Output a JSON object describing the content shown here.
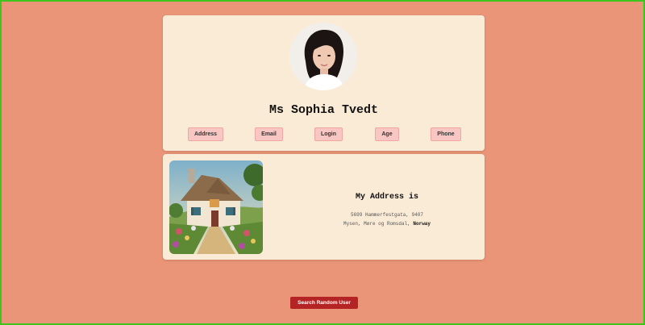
{
  "profile": {
    "name": "Ms Sophia Tvedt",
    "tabs": [
      "Address",
      "Email",
      "Login",
      "Age",
      "Phone"
    ]
  },
  "address": {
    "title": "My Address is",
    "line1": "5699 Hammerfestgata, 9407",
    "line2_prefix": "Mysen, Møre og Romsdal,",
    "country": "Norway"
  },
  "actions": {
    "search_label": "Search Random User"
  },
  "colors": {
    "background": "#ea9577",
    "card": "#faebd7",
    "tab_bg": "#f8c7c3",
    "button": "#b52424",
    "frame_border": "#3ec41f"
  },
  "icons": {
    "avatar": "profile-photo",
    "house": "house-painting"
  }
}
